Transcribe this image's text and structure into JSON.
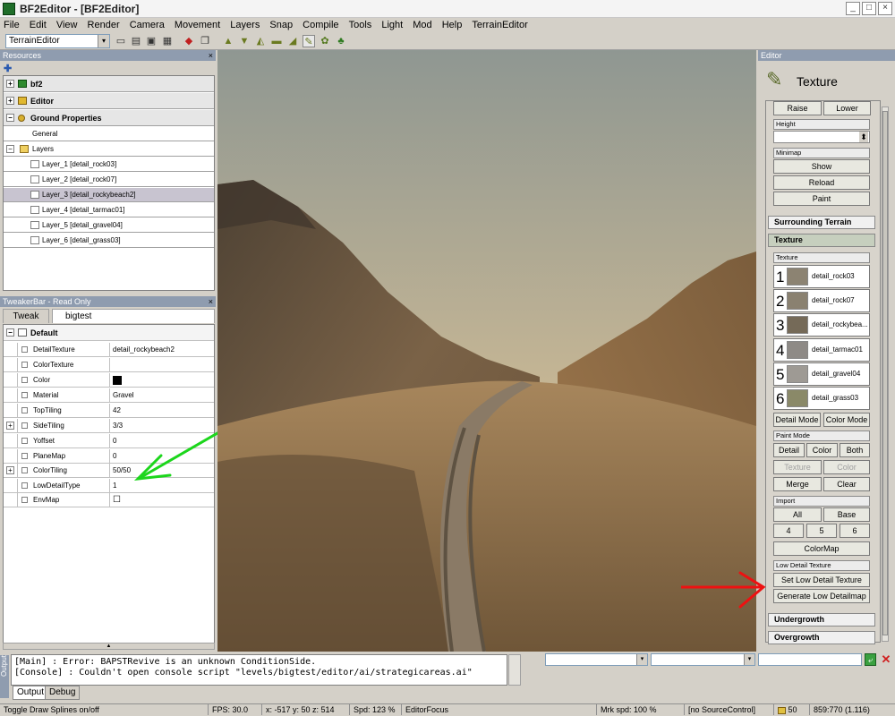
{
  "window": {
    "title": "BF2Editor - [BF2Editor]",
    "btn_min": "_",
    "btn_max": "□",
    "btn_close": "×"
  },
  "menu": [
    "File",
    "Edit",
    "View",
    "Render",
    "Camera",
    "Movement",
    "Layers",
    "Snap",
    "Compile",
    "Tools",
    "Light",
    "Mod",
    "Help",
    "TerrainEditor"
  ],
  "toolbar": {
    "editor_select": "TerrainEditor",
    "combo_arrow": "▾"
  },
  "resources": {
    "title": "Resources",
    "add": "✚",
    "close": "×",
    "tree": [
      {
        "label": "bf2",
        "exp": "+"
      },
      {
        "label": "Editor",
        "exp": "+"
      },
      {
        "label": "Ground Properties",
        "exp": "−"
      },
      {
        "label": "General"
      },
      {
        "label": "Layers",
        "exp": "−"
      },
      {
        "label": "Layer_1 [detail_rock03]"
      },
      {
        "label": "Layer_2 [detail_rock07]"
      },
      {
        "label": "Layer_3 [detail_rockybeach2]"
      },
      {
        "label": "Layer_4 [detail_tarmac01]"
      },
      {
        "label": "Layer_5 [detail_gravel04]"
      },
      {
        "label": "Layer_6 [detail_grass03]"
      }
    ]
  },
  "tweakbar": {
    "title": "TweakerBar - Read Only",
    "close": "×",
    "tabs": [
      "Tweak",
      "bigtest"
    ],
    "group": "Default",
    "group_exp": "−",
    "plus": "+",
    "scroll_up": "▲",
    "props": [
      {
        "name": "DetailTexture",
        "value": "detail_rockybeach2"
      },
      {
        "name": "ColorTexture",
        "value": ""
      },
      {
        "name": "Color",
        "value": ""
      },
      {
        "name": "Material",
        "value": "Gravel"
      },
      {
        "name": "TopTiling",
        "value": "42"
      },
      {
        "name": "SideTiling",
        "value": "3/3"
      },
      {
        "name": "Yoffset",
        "value": "0"
      },
      {
        "name": "PlaneMap",
        "value": "0"
      },
      {
        "name": "ColorTiling",
        "value": "50/50"
      },
      {
        "name": "LowDetailType",
        "value": "1"
      },
      {
        "name": "EnvMap",
        "value": "☐"
      }
    ]
  },
  "editor": {
    "title": "Editor",
    "heading": "Texture",
    "raise": "Raise",
    "lower": "Lower",
    "height_label": "Height",
    "height_spin": "⬍",
    "minimap_label": "Minimap",
    "show": "Show",
    "reload": "Reload",
    "paint": "Paint",
    "surrounding": "Surrounding Terrain",
    "texture_section": "Texture",
    "texture_label": "Texture",
    "textures": [
      {
        "num": "1",
        "name": "detail_rock03",
        "color": "#8c8372"
      },
      {
        "num": "2",
        "name": "detail_rock07",
        "color": "#8a8170"
      },
      {
        "num": "3",
        "name": "detail_rockybea...",
        "color": "#756a58"
      },
      {
        "num": "4",
        "name": "detail_tarmac01",
        "color": "#8e8a86"
      },
      {
        "num": "5",
        "name": "detail_gravel04",
        "color": "#9e9a94"
      },
      {
        "num": "6",
        "name": "detail_grass03",
        "color": "#8a8968"
      }
    ],
    "detail_mode": "Detail Mode",
    "color_mode": "Color Mode",
    "paint_mode_label": "Paint Mode",
    "pm_detail": "Detail",
    "pm_color": "Color",
    "pm_both": "Both",
    "pm_texture": "Texture",
    "pm_color2": "Color",
    "merge": "Merge",
    "clear": "Clear",
    "import_label": "Import",
    "imp_all": "All",
    "imp_base": "Base",
    "imp_4": "4",
    "imp_5": "5",
    "imp_6": "6",
    "colormap": "ColorMap",
    "low_detail_label": "Low Detail Texture",
    "set_low": "Set Low Detail Texture",
    "gen_low": "Generate Low Detailmap",
    "undergrowth": "Undergrowth",
    "overgrowth": "Overgrowth"
  },
  "output": {
    "side_label": "Output",
    "lines": [
      "[Main] : Error: BAPSTRevive is an unknown ConditionSide.",
      "[Console] : Couldn't open console script \"levels/bigtest/editor/ai/strategicareas.ai\""
    ],
    "tabs": [
      "Output",
      "Debug"
    ],
    "dd_arrow": "▾",
    "close": "✕"
  },
  "status": {
    "hint": "Toggle Draw Splines on/off",
    "fps": "FPS: 30.0",
    "coords": "x: -517 y: 50 z: 514",
    "spd": "Spd: 123 %",
    "focus": "EditorFocus",
    "mrk": "Mrk spd: 100 %",
    "source": "[no SourceControl]",
    "count": "50",
    "res": "859:770 (1.116)"
  },
  "annotations": {
    "green_arrow_color": "#1cd61c",
    "red_arrow_color": "#ee1111"
  }
}
